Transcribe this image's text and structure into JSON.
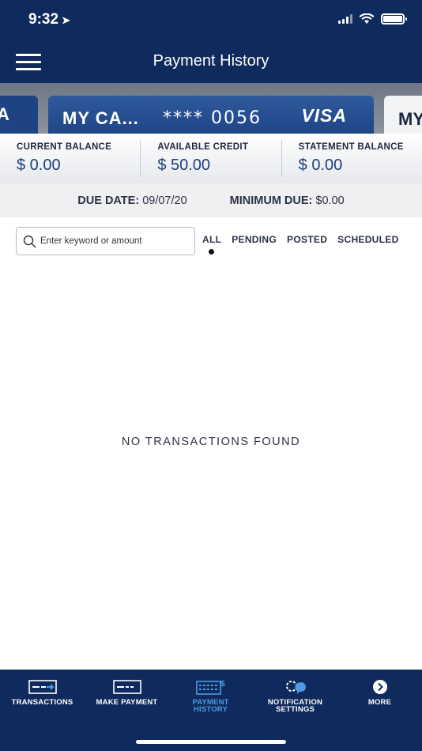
{
  "status": {
    "time": "9:32"
  },
  "header": {
    "title": "Payment History"
  },
  "cards": {
    "prev_label": "A",
    "main_name": "MY CA...",
    "main_number": "**** 0056",
    "main_brand": "VISA",
    "next_label": "MY"
  },
  "balances": [
    {
      "label": "CURRENT BALANCE",
      "value": "$ 0.00"
    },
    {
      "label": "AVAILABLE CREDIT",
      "value": "$ 50.00"
    },
    {
      "label": "STATEMENT BALANCE",
      "value": "$ 0.00"
    }
  ],
  "due": {
    "due_label": "DUE DATE:",
    "due_value": "09/07/20",
    "min_label": "MINIMUM DUE:",
    "min_value": "$0.00"
  },
  "search": {
    "placeholder": "Enter keyword or amount"
  },
  "filters": {
    "selected": "ALL",
    "items": [
      "ALL",
      "PENDING",
      "POSTED",
      "SCHEDULED"
    ]
  },
  "empty_message": "NO TRANSACTIONS FOUND",
  "tabs": {
    "active": "PAYMENT HISTORY",
    "items": [
      {
        "label": "TRANSACTIONS",
        "icon": "transactions-icon"
      },
      {
        "label": "MAKE PAYMENT",
        "icon": "card-icon"
      },
      {
        "label": "PAYMENT HISTORY",
        "icon": "calendar-icon"
      },
      {
        "label": "NOTIFICATION SETTINGS",
        "icon": "notification-gear-icon"
      },
      {
        "label": "MORE",
        "icon": "chevron-right-circle-icon"
      }
    ]
  },
  "colors": {
    "navy": "#0f2a5c",
    "card_blue": "#1d4587",
    "active_tab": "#4d9be6"
  }
}
